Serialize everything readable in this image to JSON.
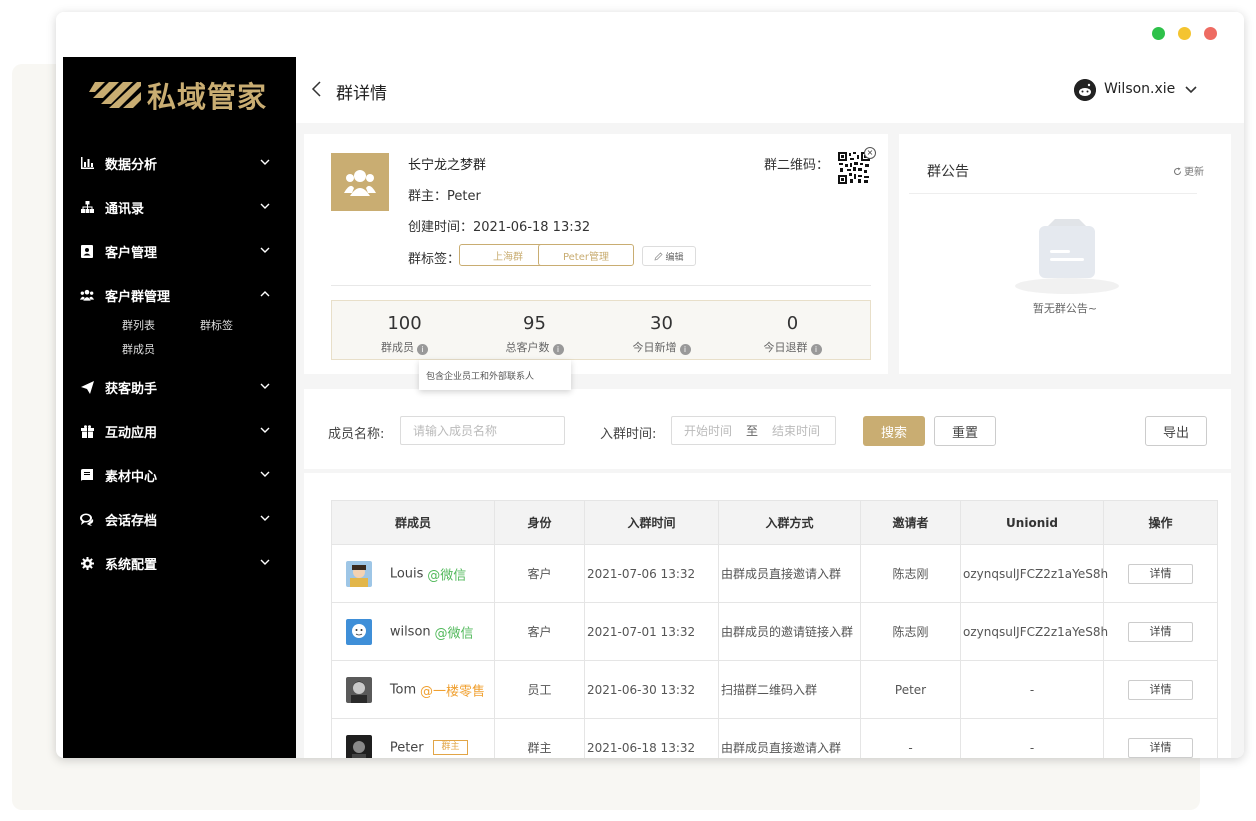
{
  "window": {
    "controls": [
      "green",
      "yellow",
      "red"
    ]
  },
  "sidebar": {
    "logo_text": "私域管家",
    "items": [
      {
        "label": "数据分析",
        "icon": "bar-chart-icon",
        "expanded": false
      },
      {
        "label": "通讯录",
        "icon": "org-tree-icon",
        "expanded": false
      },
      {
        "label": "客户管理",
        "icon": "contact-book-icon",
        "expanded": false
      },
      {
        "label": "客户群管理",
        "icon": "users-icon",
        "expanded": true
      },
      {
        "label": "获客助手",
        "icon": "paper-plane-icon",
        "expanded": false
      },
      {
        "label": "互动应用",
        "icon": "gift-icon",
        "expanded": false
      },
      {
        "label": "素材中心",
        "icon": "book-icon",
        "expanded": false
      },
      {
        "label": "会话存档",
        "icon": "chat-icon",
        "expanded": false
      },
      {
        "label": "系统配置",
        "icon": "gear-icon",
        "expanded": false
      }
    ],
    "subitems": {
      "group_list": "群列表",
      "group_tags": "群标签",
      "group_members": "群成员"
    }
  },
  "header": {
    "title": "群详情",
    "user_name": "Wilson.xie"
  },
  "group": {
    "name": "长宁龙之梦群",
    "owner": "群主：Peter",
    "created": "创建时间：2021-06-18 13:32",
    "tags_label": "群标签：",
    "tags": [
      "上海群",
      "Peter管理"
    ],
    "edit_label": "编辑",
    "qr_label": "群二维码："
  },
  "stats": [
    {
      "value": "100",
      "label": "群成员"
    },
    {
      "value": "95",
      "label": "总客户数"
    },
    {
      "value": "30",
      "label": "今日新增"
    },
    {
      "value": "0",
      "label": "今日退群"
    }
  ],
  "tooltip": "包含企业员工和外部联系人",
  "notice": {
    "title": "群公告",
    "refresh": "更新",
    "empty": "暂无群公告~"
  },
  "filter": {
    "member_label": "成员名称:",
    "member_placeholder": "请输入成员名称",
    "time_label": "入群时间:",
    "start_placeholder": "开始时间",
    "range_sep": "至",
    "end_placeholder": "结束时间",
    "search": "搜索",
    "reset": "重置",
    "export": "导出"
  },
  "table": {
    "headers": [
      "群成员",
      "身份",
      "入群时间",
      "入群方式",
      "邀请者",
      "Unionid",
      "操作"
    ],
    "rows": [
      {
        "name": "Louis",
        "tag": "@微信",
        "tag_color": "green",
        "role": "客户",
        "time": "2021-07-06 13:32",
        "method": "由群成员直接邀请入群",
        "inviter": "陈志刚",
        "unionid": "ozynqsulJFCZ2z1aYeS8h",
        "action": "详情"
      },
      {
        "name": "wilson",
        "tag": "@微信",
        "tag_color": "green",
        "role": "客户",
        "time": "2021-07-01 13:32",
        "method": "由群成员的邀请链接入群",
        "inviter": "陈志刚",
        "unionid": "ozynqsulJFCZ2z1aYeS8h",
        "action": "详情"
      },
      {
        "name": "Tom",
        "tag": "@一楼零售",
        "tag_color": "orange",
        "role": "员工",
        "time": "2021-06-30 13:32",
        "method": "扫描群二维码入群",
        "inviter": "Peter",
        "unionid": "-",
        "action": "详情"
      },
      {
        "name": "Peter",
        "badge": "群主",
        "role": "群主",
        "time": "2021-06-18 13:32",
        "method": "由群成员直接邀请入群",
        "inviter": "-",
        "unionid": "-",
        "action": "详情"
      }
    ]
  },
  "colors": {
    "accent": "#c9ad72",
    "sidebar_bg": "#000000",
    "wechat_green": "#52b95b",
    "staff_orange": "#f0a030"
  }
}
